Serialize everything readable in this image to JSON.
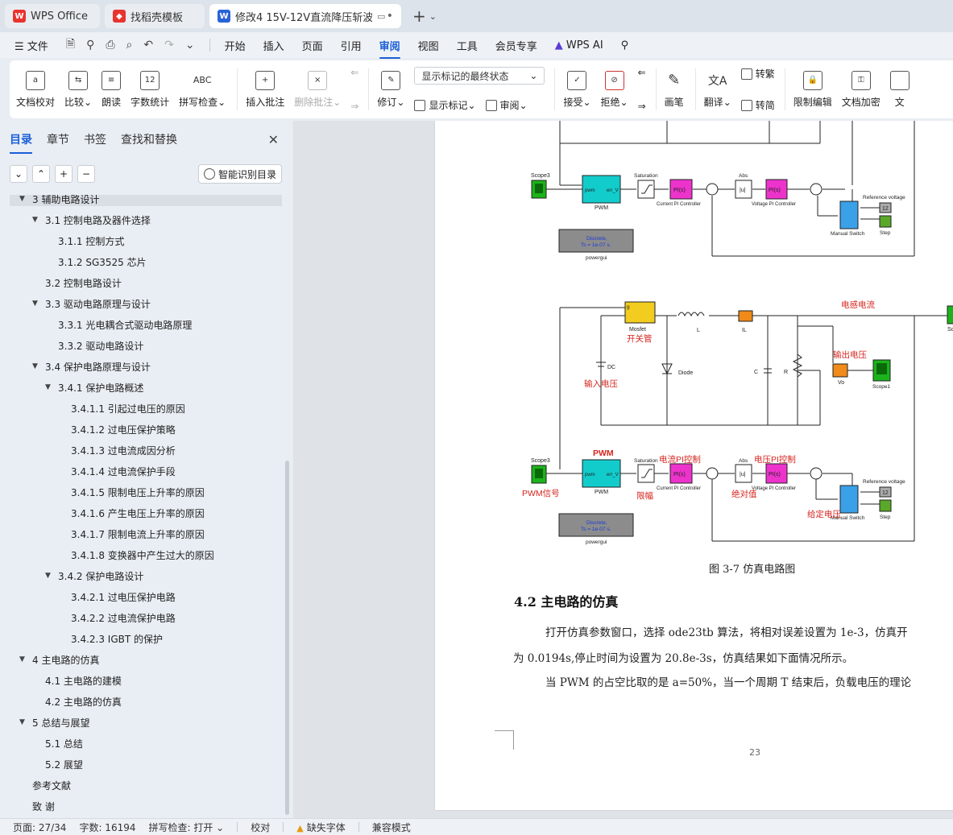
{
  "tabs": [
    {
      "label": "WPS Office",
      "icon": "wps-logo-icon"
    },
    {
      "label": "找稻壳模板",
      "icon": "docer-icon"
    },
    {
      "label": "修改4 15V-12V直流降压斩波",
      "icon": "writer-doc-icon",
      "active": true
    }
  ],
  "menu": {
    "file": "文件",
    "items": [
      "开始",
      "插入",
      "页面",
      "引用",
      "审阅",
      "视图",
      "工具",
      "会员专享"
    ],
    "active": "审阅",
    "ai": "WPS AI"
  },
  "ribbon": {
    "proofread": "文档校对",
    "compare": "比较",
    "read_aloud": "朗读",
    "word_count": "字数统计",
    "spell_check": "拼写检查",
    "insert_comment": "插入批注",
    "delete_comment": "删除批注",
    "track_changes": "修订",
    "display_mode": "显示标记的最终状态",
    "show_markup": "显示标记",
    "review": "审阅",
    "accept": "接受",
    "reject": "拒绝",
    "pen": "画笔",
    "translate": "翻译",
    "to_traditional": "转繁",
    "to_simplified": "转简",
    "restrict_edit": "限制编辑",
    "encrypt": "文档加密",
    "more": "文"
  },
  "nav": {
    "tabs": [
      "目录",
      "章节",
      "书签",
      "查找和替换"
    ],
    "active_tab": "目录",
    "smart_toc": "智能识别目录",
    "toc": [
      {
        "text": "3  辅助电路设计",
        "level": 0,
        "arrow": "▼"
      },
      {
        "text": "3.1 控制电路及器件选择",
        "level": 1,
        "arrow": "▼"
      },
      {
        "text": "3.1.1  控制方式",
        "level": 2,
        "arrow": ""
      },
      {
        "text": "3.1.2 SG3525 芯片",
        "level": 2,
        "arrow": ""
      },
      {
        "text": "3.2 控制电路设计",
        "level": 1,
        "arrow": ""
      },
      {
        "text": "3.3  驱动电路原理与设计",
        "level": 1,
        "arrow": "▼"
      },
      {
        "text": "3.3.1  光电耦合式驱动电路原理",
        "level": 2,
        "arrow": ""
      },
      {
        "text": "3.3.2  驱动电路设计",
        "level": 2,
        "arrow": ""
      },
      {
        "text": "3.4 保护电路原理与设计",
        "level": 1,
        "arrow": "▼"
      },
      {
        "text": "3.4.1 保护电路概述",
        "level": 2,
        "arrow": "▼"
      },
      {
        "text": "3.4.1.1  引起过电压的原因",
        "level": 3,
        "arrow": ""
      },
      {
        "text": "3.4.1.2  过电压保护策略",
        "level": 3,
        "arrow": ""
      },
      {
        "text": "3.4.1.3  过电流成因分析",
        "level": 3,
        "arrow": ""
      },
      {
        "text": "3.4.1.4  过电流保护手段",
        "level": 3,
        "arrow": ""
      },
      {
        "text": "3.4.1.5  限制电压上升率的原因",
        "level": 3,
        "arrow": ""
      },
      {
        "text": "3.4.1.6  产生电压上升率的原因",
        "level": 3,
        "arrow": ""
      },
      {
        "text": "3.4.1.7  限制电流上升率的原因",
        "level": 3,
        "arrow": ""
      },
      {
        "text": "3.4.1.8  变换器中产生过大的原因",
        "level": 3,
        "arrow": ""
      },
      {
        "text": "3.4.2  保护电路设计",
        "level": 2,
        "arrow": "▼"
      },
      {
        "text": "3.4.2.1  过电压保护电路",
        "level": 3,
        "arrow": ""
      },
      {
        "text": "3.4.2.2  过电流保护电路",
        "level": 3,
        "arrow": ""
      },
      {
        "text": "3.4.2.3 IGBT 的保护",
        "level": 3,
        "arrow": ""
      },
      {
        "text": "4 主电路的仿真",
        "level": 0,
        "arrow": "▼"
      },
      {
        "text": "4.1  主电路的建模",
        "level": 1,
        "arrow": ""
      },
      {
        "text": "4.2  主电路的仿真",
        "level": 1,
        "arrow": ""
      },
      {
        "text": "5  总结与展望",
        "level": 0,
        "arrow": "▼"
      },
      {
        "text": "5.1  总结",
        "level": 1,
        "arrow": ""
      },
      {
        "text": "5.2  展望",
        "level": 1,
        "arrow": ""
      },
      {
        "text": "参考文献",
        "level": 0,
        "arrow": ""
      },
      {
        "text": "致    谢",
        "level": 0,
        "arrow": ""
      }
    ]
  },
  "document": {
    "diagram_labels": {
      "scope3": "Scope3",
      "pwm": "PWM",
      "err_v": "err_V",
      "pwm_port": "pwm",
      "saturation": "Saturation",
      "pi": "PI(s)",
      "current_pi": "Current PI Controller",
      "voltage_pi": "Voltage PI Controller",
      "abs": "Abs",
      "abs_sym": "|u|",
      "ref_voltage": "Reference voltage",
      "const12": "12",
      "manual_switch": "Manual Switch",
      "step": "Step",
      "discrete": "Discrete,",
      "ts": "Ts = 1e-07 s.",
      "powergui": "powergui",
      "mosfet": "Mosfet",
      "g": "g",
      "l": "L",
      "il": "IL",
      "dc": "DC",
      "diode": "Diode",
      "c": "C",
      "r": "R",
      "vo": "Vo",
      "scope1": "Scope1",
      "sc": "Sc",
      "cn_inductor_current": "电感电流",
      "cn_switch": "开关管",
      "cn_output_voltage": "输出电压",
      "cn_input_voltage": "输入电压",
      "cn_pwm": "PWM",
      "cn_current_pi": "电流PI控制",
      "cn_voltage_pi": "电压PI控制",
      "cn_pwm_signal": "PWM信号",
      "cn_limit": "限幅",
      "cn_abs": "绝对值",
      "cn_setpoint": "给定电压"
    },
    "caption": "图 3-7 仿真电路图",
    "heading": "4.2  主电路的仿真",
    "para1_line1": "打开仿真参数窗口，选择 ode23tb 算法，将相对误差设置为 1e-3，仿真开",
    "para1_line2": "为 0.0194s,停止时间为设置为 20.8e-3s，仿真结果如下面情况所示。",
    "para2_line1": "当 PWM 的占空比取的是 a=50%，当一个周期 T 结束后，负载电压的理论",
    "page_number": "23"
  },
  "status": {
    "page": "页面: 27/34",
    "words": "字数: 16194",
    "spell": "拼写检查: 打开",
    "proof": "校对",
    "missing_font": "缺失字体",
    "compat": "兼容模式"
  },
  "colors": {
    "accent": "#1b5ed6",
    "scope_green": "#1bb31b",
    "pwm_cyan": "#12cccc",
    "pi_magenta": "#ee33cc",
    "annotation_red": "#d6241e",
    "mosfet_yellow": "#f2cc1e",
    "meter_orange": "#f08a18"
  }
}
